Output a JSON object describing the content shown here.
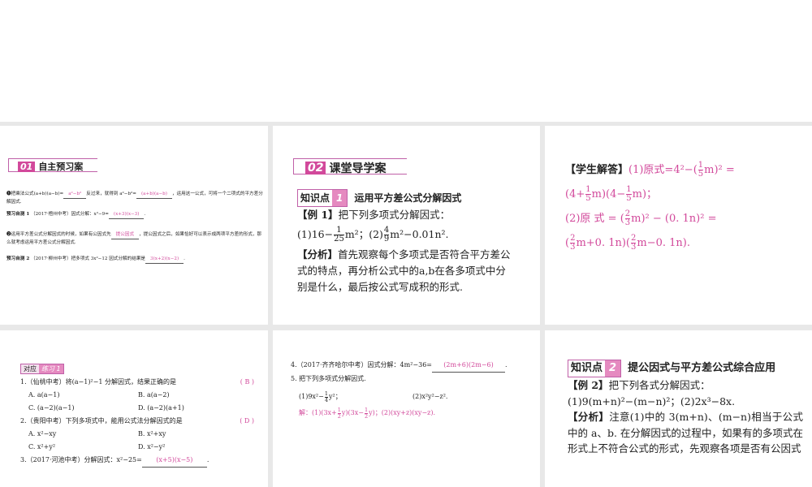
{
  "slides": {
    "s1": {
      "section_num": "01",
      "section_title": "自主预习案",
      "p1_a": "❶把乘法公式(a+b)(a−b)=",
      "p1_ans1": "a²−b²",
      "p1_b": "反过来，就得到 a²−b²=",
      "p1_ans2": "(a+b)(a−b)",
      "p1_c": "，运用这一公式，可将一个二项式的平方差分解因式.",
      "t1_label": "预习自测 1",
      "t1_text": "（2017·梧州中考）因式分解：x²−9=",
      "t1_ans": "(x+3)(x−3)",
      "p2_a": "❷运用平方差公式分解因式的时候，如果有公因式先",
      "p2_ans": "提公因式",
      "p2_b": "，提公因式之后，如果恰好可以表示成两项平方差的形式，那么就考虑运用平方差公式分解因式.",
      "t2_label": "预习自测 2",
      "t2_text": "（2017·柳州中考）把多项式 3x²−12 因式分解的结果是",
      "t2_ans": "3(x+2)(x−2)"
    },
    "s2": {
      "section_num": "02",
      "section_title": "课堂导学案",
      "kp_label": "知识点",
      "kp_num": "1",
      "kp_title": "运用平方差公式分解因式",
      "ex_label": "【例 1】",
      "ex_text": "把下列多项式分解因式：",
      "q_a": "(1)16−",
      "q_f1n": "1",
      "q_f1d": "25",
      "q_b": "m²；(2)",
      "q_f2n": "4",
      "q_f2d": "9",
      "q_c": "m²−0.01n².",
      "an_label": "【分析】",
      "an_text": "首先观察每个多项式是否符合平方差公式的特点，再分析公式中的a,b在各多项式中分别是什么，最后按公式写成积的形式."
    },
    "s3": {
      "label": "【学生解答】",
      "l1a": "(1)原式=4²−(",
      "fn": "1",
      "fd": "5",
      "l1b": "m)² =",
      "l2a": "(4+",
      "l2b": "m)(4−",
      "l2c": "m)；",
      "l3a": "(2)原 式 = (",
      "f2n": "2",
      "f2d": "3",
      "l3b": "m)² − (0. 1n)² =",
      "l4a": "(",
      "l4b": "m+0. 1n)(",
      "l4c": "m−0. 1n)."
    },
    "s4": {
      "tag_a": "对应",
      "tag_b": "练习 1",
      "q1": "1.（仙桃中考）将(a−1)²−1 分解因式，结果正确的是",
      "q1_ans": "( B )",
      "q1_opts": [
        "A. a(a−1)",
        "B. a(a−2)",
        "C. (a−2)(a−1)",
        "D. (a−2)(a+1)"
      ],
      "q2": "2.（贵阳中考）下列多项式中，能用公式法分解因式的是",
      "q2_ans": "( D )",
      "q2_opts": [
        "A. x²−xy",
        "B. x²+xy",
        "C. x²+y²",
        "D. x²−y²"
      ],
      "q3": "3.（2017·河池中考）分解因式：x²−25=",
      "q3_ans": "(x+5)(x−5)"
    },
    "s5": {
      "q4": "4.（2017·齐齐哈尔中考）因式分解：4m²−36=",
      "q4_ans": "(2m+6)(2m−6)",
      "q5": "5. 把下列多项式分解因式.",
      "p1a": "(1)9x²−",
      "fn": "1",
      "fd": "4",
      "p1b": "y²；",
      "p2": "(2)x²y²−z².",
      "sol_a": "解：(1)(3x+",
      "sol_b": "y)(3x−",
      "sol_c": "y)；(2)(xy+z)(xy−z).",
      "sfn": "1",
      "sfd": "2"
    },
    "s6": {
      "kp_label": "知识点",
      "kp_num": "2",
      "kp_title": "提公因式与平方差公式综合应用",
      "ex_label": "【例 2】",
      "ex_text": "把下列各式分解因式：",
      "q": "(1)9(m+n)²−(m−n)²；(2)2x³−8x.",
      "an_label": "【分析】",
      "an_text": "注意(1)中的 3(m+n)、(m−n)相当于公式中的 a、b. 在分解因式的过程中，如果有的多项式在形式上不符合公式的形式，先观察各项是否有公因式"
    }
  },
  "colors": {
    "accent": "#d2499b",
    "gap": "#e8e8e8"
  }
}
